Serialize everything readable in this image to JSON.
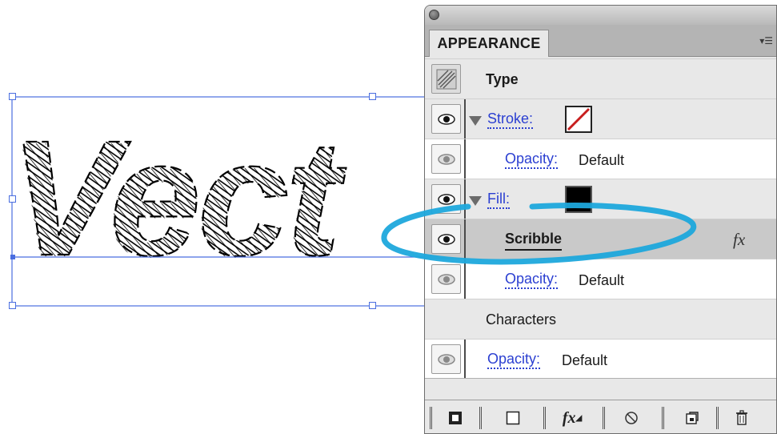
{
  "canvas": {
    "text": "Vect",
    "text_color": "#000000",
    "selection_color": "#4a6ee0",
    "highlight_color": "#1ea8dc"
  },
  "panel": {
    "tab_title": "APPEARANCE",
    "menu_icon": "panel-menu-icon",
    "rows": {
      "type_label": "Type",
      "stroke_label": "Stroke:",
      "stroke_opacity_label": "Opacity:",
      "stroke_opacity_value": "Default",
      "fill_label": "Fill:",
      "scribble_label": "Scribble",
      "fx_symbol": "fx",
      "fill_opacity_label": "Opacity:",
      "fill_opacity_value": "Default",
      "characters_label": "Characters",
      "char_opacity_label": "Opacity:",
      "char_opacity_value": "Default"
    },
    "bottom_buttons": {
      "fx_label": "fx"
    }
  }
}
